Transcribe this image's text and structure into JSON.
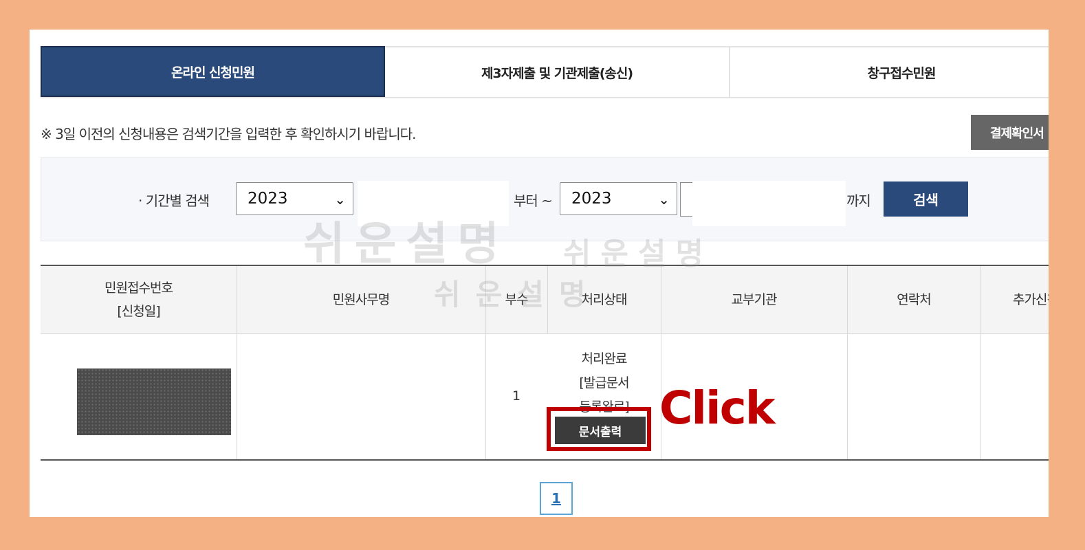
{
  "tabs": [
    {
      "label": "온라인 신청민원",
      "active": true
    },
    {
      "label": "제3자제출 및 기관제출(송신)",
      "active": false
    },
    {
      "label": "창구접수민원",
      "active": false
    }
  ],
  "notice": "※ 3일 이전의 신청내용은 검색기간을 입력한 후 확인하시기 바랍니다.",
  "pay_button": "결제확인서",
  "search": {
    "label": "기간별 검색",
    "from_year": "2023",
    "from_suffix": "부터 ~",
    "to_year": "2023",
    "to_suffix": "까지",
    "button": "검색"
  },
  "table": {
    "headers": {
      "receipt_no_line1": "민원접수번호",
      "receipt_no_line2": "[신청일]",
      "name": "민원사무명",
      "copies": "부수",
      "status": "처리상태",
      "issuer": "교부기관",
      "contact": "연락처",
      "extra": "추가신청"
    },
    "rows": [
      {
        "copies": "1",
        "status_line1": "처리완료",
        "status_line2": "[발급문서",
        "status_line3": "등록완료]",
        "print_button": "문서출력"
      }
    ]
  },
  "annotation": {
    "click_label": "Click",
    "color": "#c00000"
  },
  "watermark": {
    "large": "쉬운설명",
    "small": "쉬운설명",
    "mid": "쉬운설명"
  },
  "pagination": {
    "current": "1"
  },
  "colors": {
    "primary": "#2a4a7b",
    "frame": "#f4b184"
  }
}
